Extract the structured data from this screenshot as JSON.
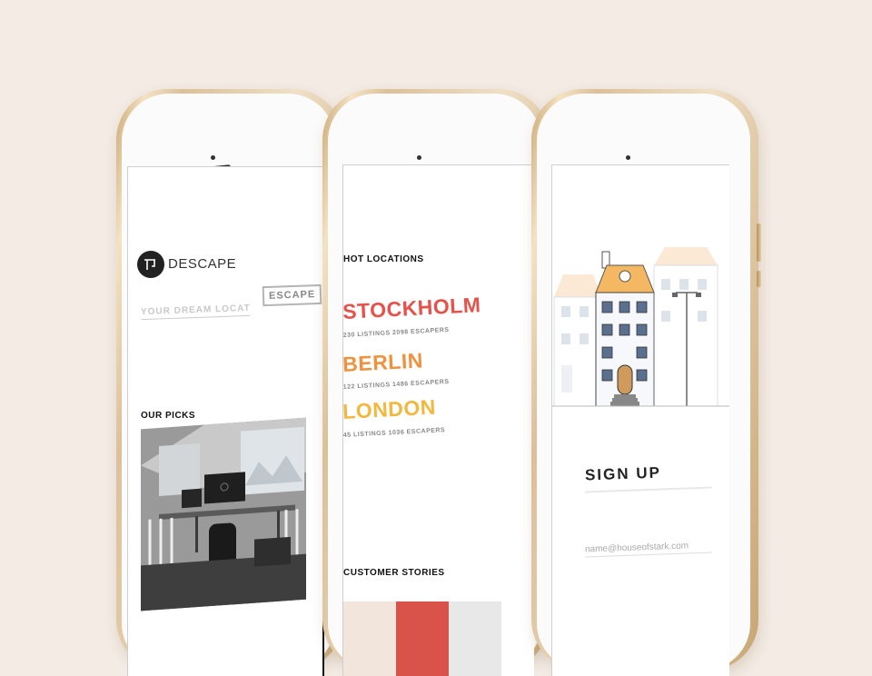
{
  "brand": {
    "name": "DESCAPE"
  },
  "search": {
    "placeholder": "YOUR DREAM LOCATION",
    "button_label": "ESCAPE"
  },
  "picks": {
    "title": "OUR PICKS"
  },
  "hot_locations": {
    "title": "HOT LOCATIONS",
    "cities": [
      {
        "name": "STOCKHOLM",
        "meta": "230 LISTINGS   2098 ESCAPERS",
        "color": "#e8514a"
      },
      {
        "name": "BERLIN",
        "meta": "122 LISTINGS   1486 ESCAPERS",
        "color": "#f0913e"
      },
      {
        "name": "LONDON",
        "meta": "45 LISTINGS   1036 ESCAPERS",
        "color": "#f4b73d"
      }
    ]
  },
  "customer_stories": {
    "title": "CUSTOMER STORIES"
  },
  "signup": {
    "title": "SIGN UP",
    "email_placeholder": "name@houseofstark.com"
  },
  "colors": {
    "background": "#f3ebe4",
    "gold": "#dcc099",
    "accent_red": "#e8514a",
    "story_red": "#d9534a"
  }
}
